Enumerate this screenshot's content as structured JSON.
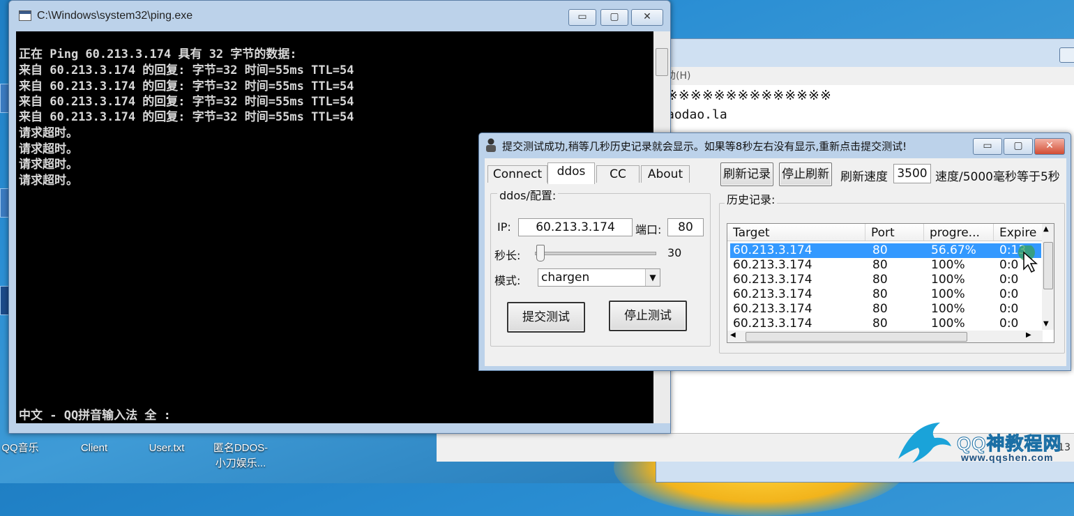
{
  "desktop": {
    "icons": [
      {
        "label": "QQ音乐"
      },
      {
        "label": "Client"
      },
      {
        "label": "User.txt"
      },
      {
        "label": "匿名DDOS-",
        "label2": "小刀娱乐..."
      }
    ]
  },
  "background_window": {
    "menu_text": "助(H)",
    "line1": "※※※※※※※※※※※※※※",
    "line2": "aodao.la",
    "status_text": "13"
  },
  "console_window": {
    "title": "C:\\Windows\\system32\\ping.exe",
    "lines": [
      "正在 Ping 60.213.3.174 具有 32 字节的数据:",
      "来自 60.213.3.174 的回复: 字节=32 时间=55ms TTL=54",
      "来自 60.213.3.174 的回复: 字节=32 时间=55ms TTL=54",
      "来自 60.213.3.174 的回复: 字节=32 时间=55ms TTL=54",
      "来自 60.213.3.174 的回复: 字节=32 时间=55ms TTL=54",
      "请求超时。",
      "请求超时。",
      "请求超时。",
      "请求超时。"
    ],
    "ime_status": "中文 - QQ拼音输入法 全 :",
    "buttons": {
      "minimize": "▭",
      "maximize": "▢",
      "close": "✕"
    }
  },
  "ddos_dialog": {
    "title": "提交测试成功,稍等几秒历史记录就会显示。如果等8秒左右没有显示,重新点击提交测试!",
    "tabs": [
      {
        "label": "Connect",
        "active": false
      },
      {
        "label": "ddos",
        "active": true
      },
      {
        "label": "CC",
        "active": false
      },
      {
        "label": "About",
        "active": false
      }
    ],
    "config": {
      "group_label": "ddos/配置:",
      "ip_label": "IP:",
      "ip_value": "60.213.3.174",
      "port_label": "端口:",
      "port_value": "80",
      "duration_label": "秒长:",
      "duration_value": "30",
      "mode_label": "模式:",
      "mode_value": "chargen",
      "submit_button": "提交测试",
      "stop_button": "停止测试"
    },
    "toolbar": {
      "refresh_button": "刷新记录",
      "stop_refresh_button": "停止刷新",
      "speed_label": "刷新速度",
      "speed_value": "3500",
      "speed_note": "速度/5000毫秒等于5秒"
    },
    "history": {
      "group_label": "历史记录:",
      "columns": [
        "Target",
        "Port",
        "progre...",
        "Expire"
      ],
      "rows": [
        {
          "target": "60.213.3.174",
          "port": "80",
          "progress": "56.67%",
          "expire": "0:13",
          "selected": true
        },
        {
          "target": "60.213.3.174",
          "port": "80",
          "progress": "100%",
          "expire": "0:0",
          "selected": false
        },
        {
          "target": "60.213.3.174",
          "port": "80",
          "progress": "100%",
          "expire": "0:0",
          "selected": false
        },
        {
          "target": "60.213.3.174",
          "port": "80",
          "progress": "100%",
          "expire": "0:0",
          "selected": false
        },
        {
          "target": "60.213.3.174",
          "port": "80",
          "progress": "100%",
          "expire": "0:0",
          "selected": false
        },
        {
          "target": "60.213.3.174",
          "port": "80",
          "progress": "100%",
          "expire": "0:0",
          "selected": false
        }
      ]
    }
  },
  "watermark": {
    "title": "QQ神教程网",
    "url": "www.qqshen.com"
  }
}
